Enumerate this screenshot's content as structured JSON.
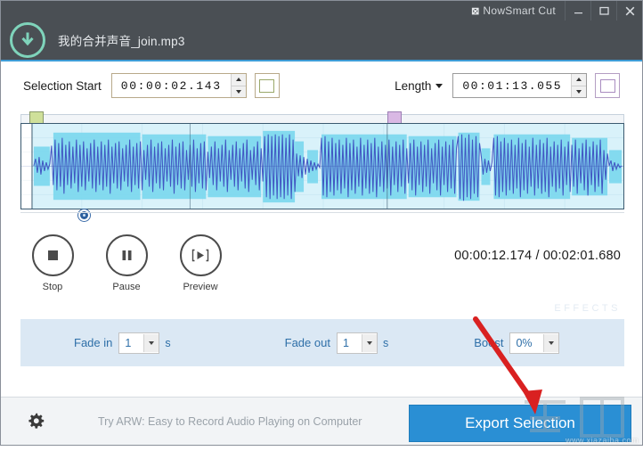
{
  "window": {
    "app_title": "NowSmart Cut",
    "logo_glyph": "logo-icon",
    "minimize": "minimize-icon",
    "maximize": "maximize-icon",
    "close": "close-icon"
  },
  "header": {
    "file_name": "我的合并声音_join.mp3",
    "file_icon": "download-circle-icon"
  },
  "selection": {
    "start_label": "Selection Start",
    "start_value": "00:00:02.143",
    "start_swatch_color": "#cfe09a",
    "length_label": "Length",
    "length_value": "00:01:13.055",
    "length_swatch_color": "#d9b8e4"
  },
  "waveform": {
    "start_marker_color": "#cfe09a",
    "end_marker_color": "#d9b8e4",
    "selection_fill": "#8fe0f2",
    "wave_color": "#3a4fc4"
  },
  "transport": {
    "buttons": [
      {
        "label": "Stop",
        "icon": "stop-icon"
      },
      {
        "label": "Pause",
        "icon": "pause-icon"
      },
      {
        "label": "Preview",
        "icon": "preview-play-icon"
      }
    ],
    "timecode": "00:00:12.174 / 00:02:01.680"
  },
  "effects": {
    "title": "EFFECTS",
    "fade_in_label": "Fade in",
    "fade_in_value": "1",
    "fade_in_unit": "s",
    "fade_out_label": "Fade out",
    "fade_out_value": "1",
    "fade_out_unit": "s",
    "boost_label": "Boost",
    "boost_value": "0%"
  },
  "bottom": {
    "settings_icon": "gear-icon",
    "promo_text": "Try ARW: Easy to Record Audio Playing on Computer",
    "export_label": "Export Selection",
    "export_color": "#2a8fd4"
  },
  "annotation": {
    "arrow_color": "#d92121"
  },
  "watermark": {
    "url_text": "www.xiazaiba.com"
  }
}
